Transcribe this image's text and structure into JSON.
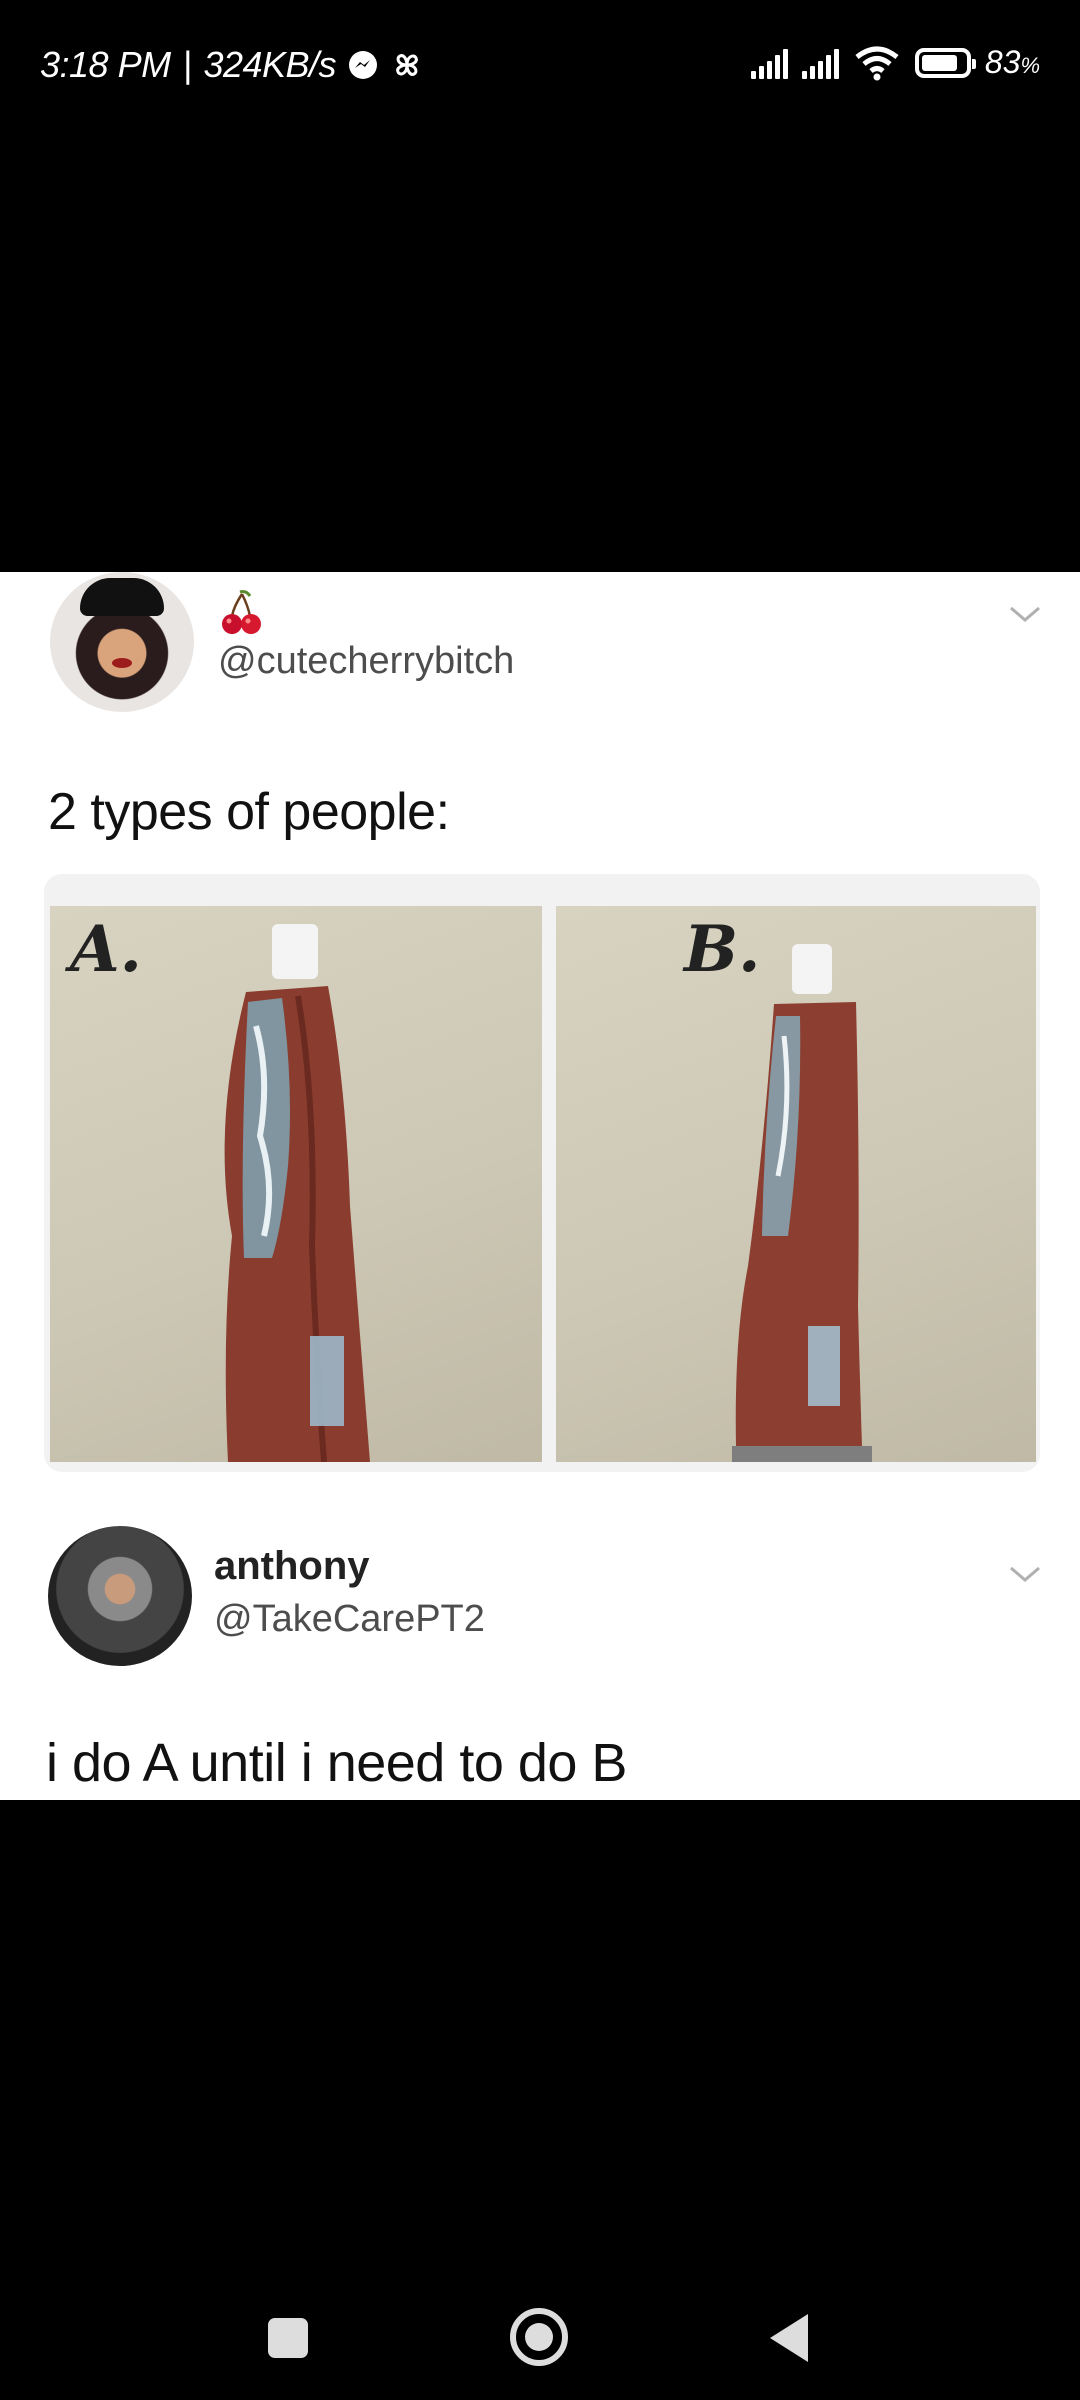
{
  "status_bar": {
    "time": "3:18 PM",
    "separator": "|",
    "speed": "324KB/s",
    "battery": "83",
    "battery_unit": "%",
    "battery_level": 0.83,
    "icons": [
      "messenger-icon",
      "pinwheel-icon",
      "signal-icon",
      "signal-icon",
      "wifi-icon",
      "battery-icon"
    ]
  },
  "post": {
    "tweet1": {
      "emoji": "cherry",
      "handle": "@cutecherrybitch",
      "text": "2 types of people:"
    },
    "photos": {
      "a_label": "A.",
      "b_label": "B."
    },
    "tweet2": {
      "name": "anthony",
      "handle": "@TakeCarePT2",
      "text": "i do A until i need to do B"
    }
  },
  "nav_bar": {
    "icons": [
      "recents-icon",
      "home-icon",
      "back-icon"
    ]
  },
  "colors": {
    "background": "#000000",
    "card": "#ffffff",
    "text": "#111111",
    "handle": "#4d4d4d"
  }
}
